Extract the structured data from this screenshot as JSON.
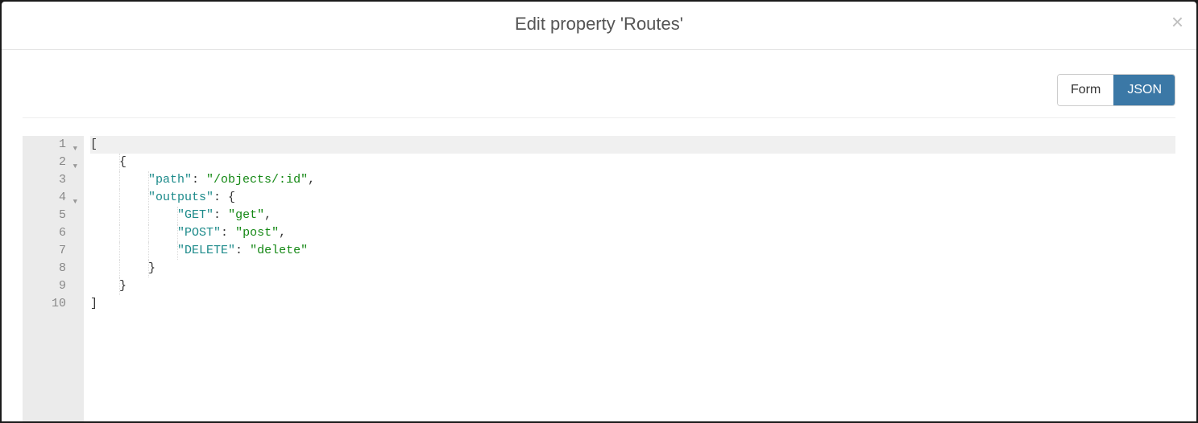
{
  "header": {
    "title": "Edit property 'Routes'"
  },
  "toolbar": {
    "form_label": "Form",
    "json_label": "JSON"
  },
  "editor": {
    "gutter": [
      "1",
      "2",
      "3",
      "4",
      "5",
      "6",
      "7",
      "8",
      "9",
      "10"
    ],
    "foldable_lines": [
      1,
      2,
      4
    ],
    "lines": [
      {
        "indent": 0,
        "tokens": [
          {
            "t": "[",
            "c": "p"
          }
        ]
      },
      {
        "indent": 1,
        "tokens": [
          {
            "t": "{",
            "c": "p"
          }
        ]
      },
      {
        "indent": 2,
        "tokens": [
          {
            "t": "\"path\"",
            "c": "k"
          },
          {
            "t": ": ",
            "c": "p"
          },
          {
            "t": "\"/objects/:id\"",
            "c": "s"
          },
          {
            "t": ",",
            "c": "p"
          }
        ]
      },
      {
        "indent": 2,
        "tokens": [
          {
            "t": "\"outputs\"",
            "c": "k"
          },
          {
            "t": ": {",
            "c": "p"
          }
        ]
      },
      {
        "indent": 3,
        "tokens": [
          {
            "t": "\"GET\"",
            "c": "k"
          },
          {
            "t": ": ",
            "c": "p"
          },
          {
            "t": "\"get\"",
            "c": "s"
          },
          {
            "t": ",",
            "c": "p"
          }
        ]
      },
      {
        "indent": 3,
        "tokens": [
          {
            "t": "\"POST\"",
            "c": "k"
          },
          {
            "t": ": ",
            "c": "p"
          },
          {
            "t": "\"post\"",
            "c": "s"
          },
          {
            "t": ",",
            "c": "p"
          }
        ]
      },
      {
        "indent": 3,
        "tokens": [
          {
            "t": "\"DELETE\"",
            "c": "k"
          },
          {
            "t": ": ",
            "c": "p"
          },
          {
            "t": "\"delete\"",
            "c": "s"
          }
        ]
      },
      {
        "indent": 2,
        "tokens": [
          {
            "t": "}",
            "c": "p"
          }
        ]
      },
      {
        "indent": 1,
        "tokens": [
          {
            "t": "}",
            "c": "p"
          }
        ]
      },
      {
        "indent": 0,
        "tokens": [
          {
            "t": "]",
            "c": "p"
          }
        ]
      }
    ]
  }
}
